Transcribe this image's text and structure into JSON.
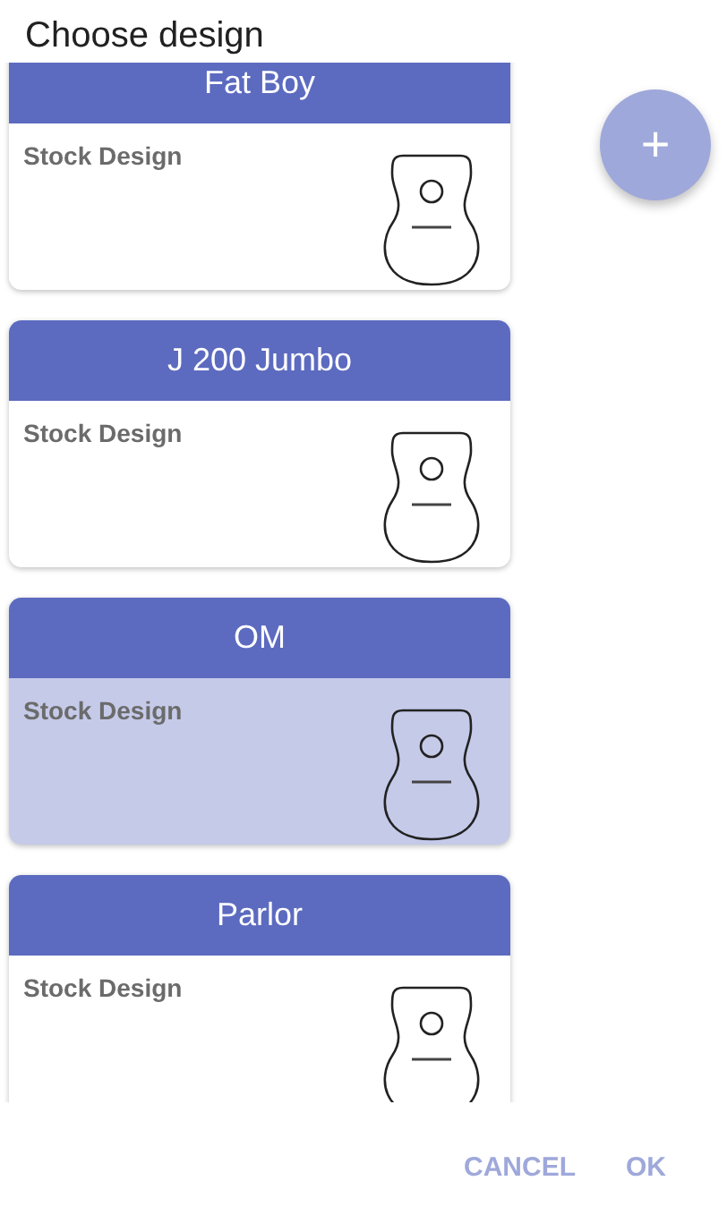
{
  "title": "Choose design",
  "designs": [
    {
      "name": "Fat Boy",
      "subtitle": "Stock Design",
      "selected": false
    },
    {
      "name": "J 200 Jumbo",
      "subtitle": "Stock Design",
      "selected": false
    },
    {
      "name": "OM",
      "subtitle": "Stock Design",
      "selected": true
    },
    {
      "name": "Parlor",
      "subtitle": "Stock Design",
      "selected": false
    }
  ],
  "fab": {
    "label": "+"
  },
  "buttons": [
    "CANCEL",
    "OK"
  ]
}
